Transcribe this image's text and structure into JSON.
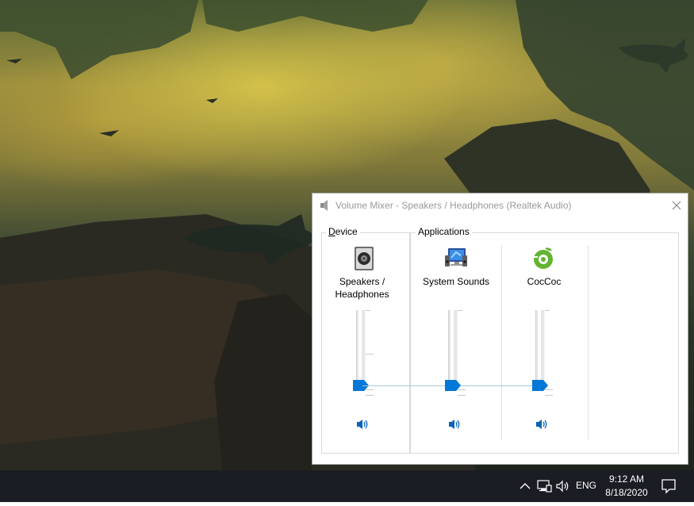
{
  "window": {
    "title": "Volume Mixer - Speakers / Headphones (Realtek Audio)",
    "close_icon": "close-icon",
    "title_icon": "speaker-icon"
  },
  "device": {
    "group_label_prefix": "",
    "group_label_access": "D",
    "group_label_rest": "evice",
    "channel": {
      "name_line1": "Speakers /",
      "name_line2": "Headphones",
      "icon": "speaker-device-icon",
      "volume": 0.0,
      "muted": false
    }
  },
  "applications": {
    "group_label": "Applications",
    "channels": [
      {
        "name": "System Sounds",
        "icon": "system-sounds-icon",
        "volume": 0.0,
        "muted": false
      },
      {
        "name": "CocCoc",
        "icon": "coccoc-icon",
        "volume": 0.0,
        "muted": false
      }
    ]
  },
  "taskbar": {
    "language": "ENG",
    "time": "9:12 AM",
    "date": "8/18/2020",
    "tray_icons": [
      "chevron-up-icon",
      "network-icon",
      "volume-icon"
    ],
    "notification_icon": "notification-icon"
  },
  "colors": {
    "accent": "#0078d7",
    "taskbar": "#1b1d24",
    "title_text": "#999999"
  }
}
